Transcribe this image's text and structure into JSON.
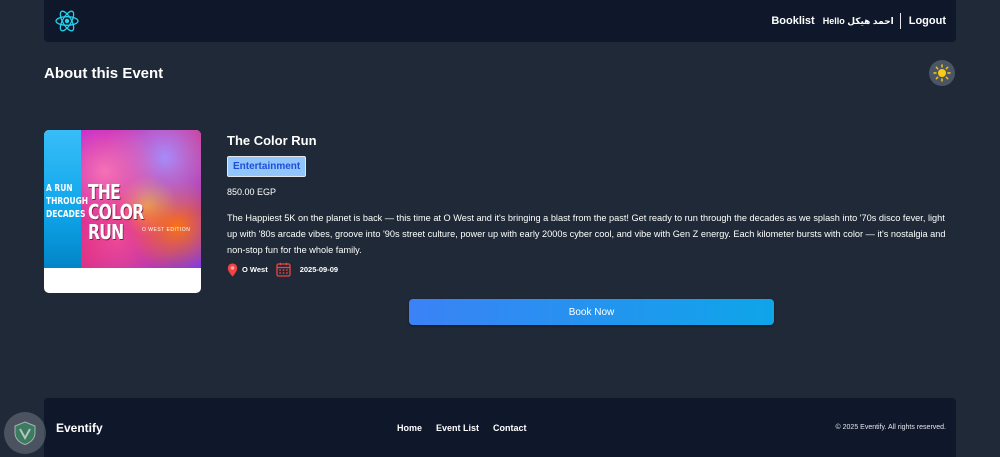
{
  "nav": {
    "booklist_label": "Booklist",
    "greeting": "Hello احمد هيكل",
    "logout_label": "Logout"
  },
  "page": {
    "title": "About this Event"
  },
  "event": {
    "title": "The Color Run",
    "category": "Entertainment",
    "price": "850.00 EGP",
    "description": "The Happiest 5K on the planet is back — this time at O West and it's bringing a blast from the past! Get ready to run through the decades as we splash into '70s disco fever, light up with '80s arcade vibes, groove into '90s street culture, power up with early 2000s cyber cool, and vibe with Gen Z energy. Each kilometer bursts with color — it's nostalgia and non-stop fun for the whole family.",
    "location": "O West",
    "date": "2025-09-09",
    "poster": {
      "title": "THE COLOR RUN",
      "subtitle": "A RUN THROUGH DECADES",
      "edition": "O WEST EDITION"
    },
    "book_label": "Book Now"
  },
  "footer": {
    "brand": "Eventify",
    "links": [
      "Home",
      "Event List",
      "Contact"
    ],
    "copyright": "© 2025 Eventify. All rights reserved."
  },
  "colors": {
    "background": "#1f2937",
    "bar": "#0f172a",
    "accent": "#3b82f6",
    "badge": "#93c5fd"
  },
  "icons": {
    "logo": "react-atom-icon",
    "theme": "sun-icon",
    "location": "pin-icon",
    "date": "calendar-icon"
  }
}
